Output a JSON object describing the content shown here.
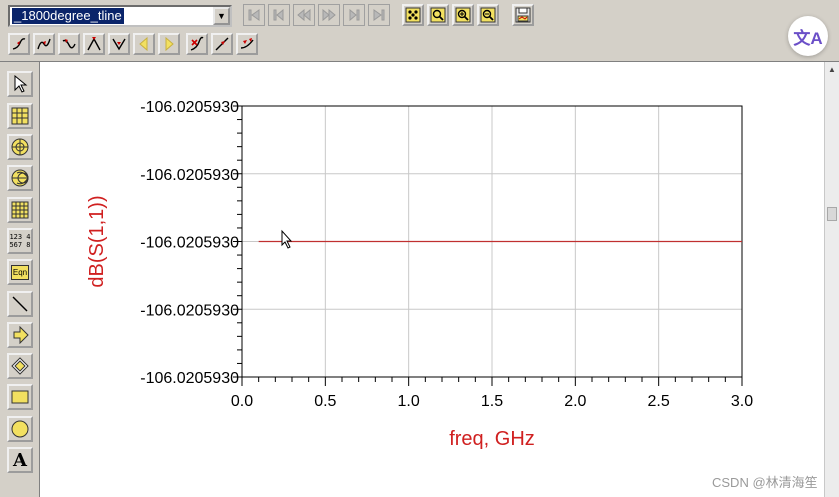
{
  "toolbar": {
    "dataset_value": "_1800degree_tline",
    "nav_buttons": [
      "first-icon",
      "prev-icon",
      "rewind-icon",
      "forward-icon",
      "next-icon",
      "last-icon"
    ],
    "view_buttons": [
      "scatter-icon",
      "zoom-region-icon",
      "zoom-in-icon",
      "zoom-out-icon",
      "save-plot-icon"
    ],
    "marker_buttons": [
      "marker-new-icon",
      "marker-freq-icon",
      "marker-min-icon",
      "marker-max-icon",
      "marker-notch-icon",
      "marker-left-icon",
      "marker-right-icon",
      "marker-x-icon",
      "marker-slope-icon",
      "marker-delta-icon"
    ]
  },
  "palette": {
    "tools": [
      "pointer-icon",
      "rectangular-plot-icon",
      "polar-plot-icon",
      "smith-chart-icon",
      "list-table-icon",
      "stacked-list-icon",
      "equation-icon",
      "line-icon",
      "polyline-icon",
      "polygon-icon",
      "rectangle-icon",
      "circle-icon",
      "text-icon"
    ],
    "list_label_top": "123 4",
    "list_label_bottom": "567 8",
    "equation_label": "Eqn",
    "text_label": "A"
  },
  "translate_button_label": "文A",
  "watermark": "CSDN @林清海笙",
  "chart_data": {
    "type": "line",
    "xlabel": "freq, GHz",
    "ylabel": "dB(S(1,1))",
    "xlim": [
      0.0,
      3.0
    ],
    "x_ticks": [
      "0.0",
      "0.5",
      "1.0",
      "1.5",
      "2.0",
      "2.5",
      "3.0"
    ],
    "y_ticks": [
      "-106.0205930",
      "-106.0205930",
      "-106.0205930",
      "-106.0205930",
      "-106.0205930"
    ],
    "grid": true,
    "series": [
      {
        "x": [
          0.1,
          3.0
        ],
        "y": [
          -106.020593,
          -106.020593
        ],
        "color": "#c03030"
      }
    ],
    "axis_label_color": "#d02020"
  }
}
